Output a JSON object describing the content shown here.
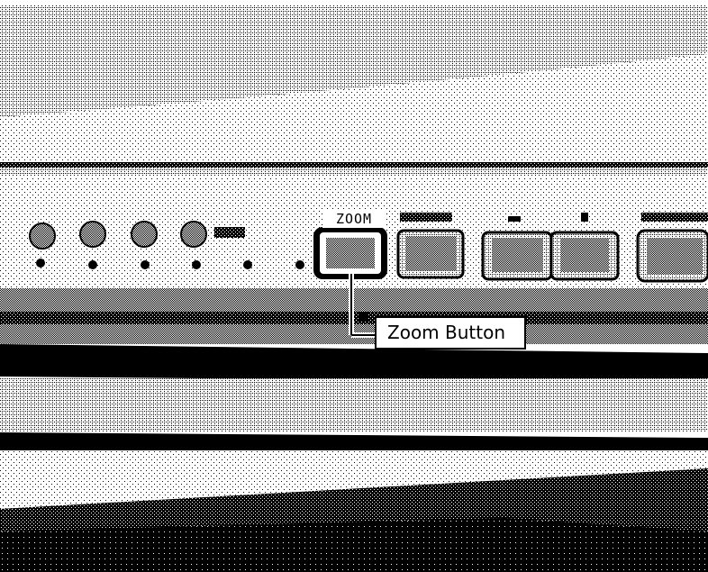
{
  "photo": {
    "subject": "Front bezel of a monitor showing control buttons"
  },
  "labels": {
    "zoom_top": "ZOOM",
    "callout": "Zoom Button"
  },
  "colors": {
    "ink": "#000000",
    "paper": "#ffffff"
  }
}
